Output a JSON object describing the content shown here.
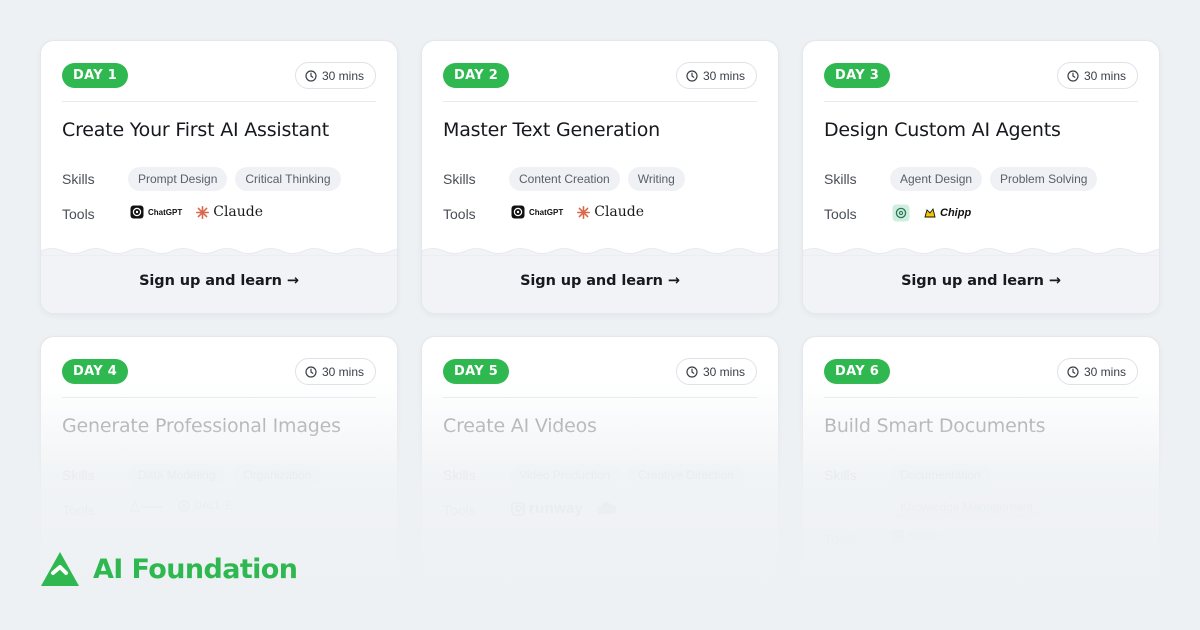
{
  "brand": {
    "name": "AI Foundation",
    "logo_icon": "mountain-logo-icon",
    "color": "#2fb84f"
  },
  "labels": {
    "skills": "Skills",
    "tools": "Tools"
  },
  "cta": "Sign up and learn →",
  "cards": [
    {
      "day": "DAY 1",
      "duration": "30 mins",
      "title": "Create Your First AI Assistant",
      "skills": [
        "Prompt Design",
        "Critical Thinking"
      ],
      "tools": [
        {
          "name": "ChatGPT",
          "icon": "chatgpt-icon"
        },
        {
          "name": "Claude",
          "icon": "claude-icon"
        }
      ]
    },
    {
      "day": "DAY 2",
      "duration": "30 mins",
      "title": "Master Text Generation",
      "skills": [
        "Content Creation",
        "Writing"
      ],
      "tools": [
        {
          "name": "ChatGPT",
          "icon": "chatgpt-icon"
        },
        {
          "name": "Claude",
          "icon": "claude-icon"
        }
      ]
    },
    {
      "day": "DAY 3",
      "duration": "30 mins",
      "title": "Design Custom AI Agents",
      "skills": [
        "Agent Design",
        "Problem Solving"
      ],
      "tools": [
        {
          "name": "",
          "icon": "chatgpt-icon"
        },
        {
          "name": "Chipp",
          "icon": "chipp-icon"
        }
      ]
    },
    {
      "day": "DAY 4",
      "duration": "30 mins",
      "title": "Generate Professional Images",
      "skills": [
        "Data Modeling",
        "Organization"
      ],
      "tools": [
        {
          "name": "",
          "icon": "midjourney-icon"
        },
        {
          "name": "DALL·E",
          "icon": "dalle-icon"
        }
      ]
    },
    {
      "day": "DAY 5",
      "duration": "30 mins",
      "title": "Create AI Videos",
      "skills": [
        "Video Production",
        "Creative Direction"
      ],
      "tools": [
        {
          "name": "runway",
          "icon": "runway-icon"
        },
        {
          "name": "",
          "icon": "cloud-icon"
        }
      ]
    },
    {
      "day": "DAY 6",
      "duration": "30 mins",
      "title": "Build Smart Documents",
      "skills": [
        "Documentation",
        "Knowledge Management"
      ],
      "tools": [
        {
          "name": "Notion",
          "icon": "notion-icon"
        }
      ]
    }
  ],
  "colors": {
    "accent": "#2fb84f",
    "background": "#eef1f4",
    "card": "#ffffff",
    "chip": "#eff1f4"
  }
}
